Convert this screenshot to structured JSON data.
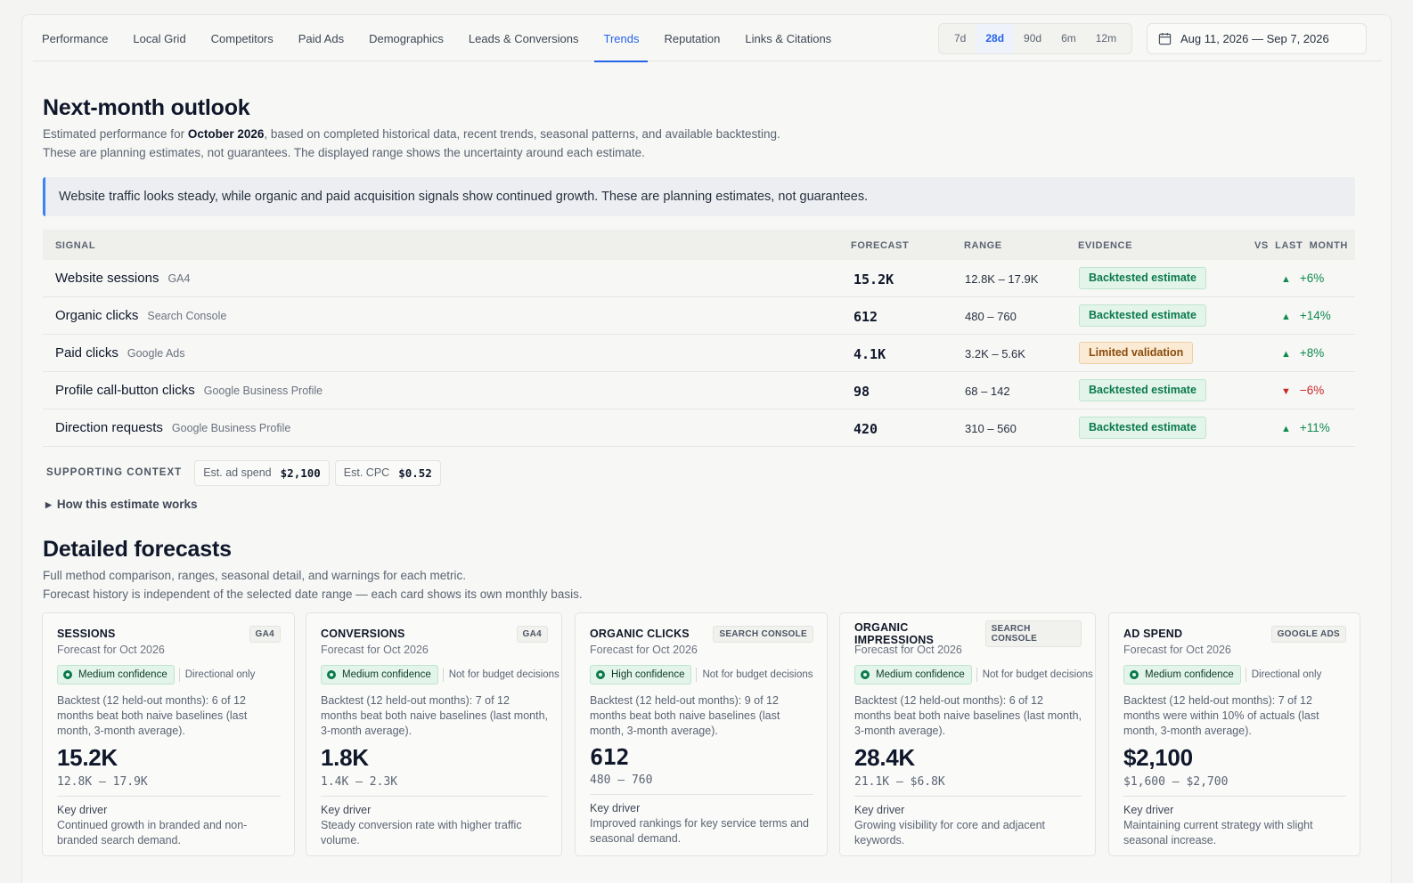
{
  "nav": {
    "tabs": [
      {
        "label": "Performance"
      },
      {
        "label": "Local Grid"
      },
      {
        "label": "Competitors"
      },
      {
        "label": "Paid Ads"
      },
      {
        "label": "Demographics"
      },
      {
        "label": "Leads & Conversions"
      },
      {
        "label": "Trends",
        "active": true
      },
      {
        "label": "Reputation"
      },
      {
        "label": "Links & Citations"
      }
    ],
    "ranges": [
      "7d",
      "28d",
      "90d",
      "6m",
      "12m"
    ],
    "active_range": "28d",
    "date_range": "Aug 11, 2026 — Sep 7, 2026"
  },
  "outlook": {
    "title": "Next-month outlook",
    "sub_pre": "Estimated performance for ",
    "sub_month": "October 2026",
    "sub_post": ", based on completed historical data, recent trends, seasonal patterns, and available backtesting.",
    "sub_line2": "These are planning estimates, not guarantees. The displayed range shows the uncertainty around each estimate.",
    "callout": "Website traffic looks steady, while organic and paid acquisition signals show continued growth. These are planning estimates, not guarantees."
  },
  "signal_table": {
    "headers": {
      "signal": "SIGNAL",
      "forecast": "FORECAST",
      "range": "RANGE",
      "evidence": "EVIDENCE",
      "vs": "VS  LAST  MONTH"
    },
    "rows": [
      {
        "signal": "Website sessions",
        "source": "GA4",
        "forecast": "15.2K",
        "range": "12.8K – 17.9K",
        "evidence": "Backtested estimate",
        "evidence_type": "green",
        "direction": "up",
        "arrow": "▲",
        "change": "+6%"
      },
      {
        "signal": "Organic clicks",
        "source": "Search Console",
        "forecast": "612",
        "range": "480 – 760",
        "evidence": "Backtested estimate",
        "evidence_type": "green",
        "direction": "up",
        "arrow": "▲",
        "change": "+14%"
      },
      {
        "signal": "Paid clicks",
        "source": "Google Ads",
        "forecast": "4.1K",
        "range": "3.2K – 5.6K",
        "evidence": "Limited validation",
        "evidence_type": "amber",
        "direction": "up",
        "arrow": "▲",
        "change": "+8%"
      },
      {
        "signal": "Profile call-button clicks",
        "source": "Google Business Profile",
        "forecast": "98",
        "range": "68 – 142",
        "evidence": "Backtested estimate",
        "evidence_type": "green",
        "direction": "down",
        "arrow": "▼",
        "change": "−6%"
      },
      {
        "signal": "Direction requests",
        "source": "Google Business Profile",
        "forecast": "420",
        "range": "310 – 560",
        "evidence": "Backtested estimate",
        "evidence_type": "green",
        "direction": "up",
        "arrow": "▲",
        "change": "+11%"
      }
    ]
  },
  "support": {
    "label": "SUPPORTING CONTEXT",
    "ad_spend_label": "Est. ad spend",
    "ad_spend_value": "$2,100",
    "cpc_label": "Est. CPC",
    "cpc_value": "$0.52",
    "howto": "How this estimate works"
  },
  "detailed": {
    "title": "Detailed forecasts",
    "sub_line1": "Full method comparison, ranges, seasonal detail, and warnings for each metric.",
    "sub_line2": "Forecast history is independent of the selected date range — each card shows its own monthly basis."
  },
  "cards": [
    {
      "title": "SESSIONS",
      "source": "GA4",
      "for": "Forecast for Oct 2026",
      "confidence": "Medium confidence",
      "note": "Directional only",
      "backtest": "Backtest (12 held-out months): 6 of 12 months beat both naive baselines (last month, 3-month average).",
      "value": "15.2K",
      "range": "12.8K – 17.9K",
      "driver_label": "Key driver",
      "driver": "Continued growth in branded and non-branded search demand."
    },
    {
      "title": "CONVERSIONS",
      "source": "GA4",
      "for": "Forecast for Oct 2026",
      "confidence": "Medium confidence",
      "note": "Not for budget decisions",
      "backtest": "Backtest (12 held-out months): 7 of 12 months beat both naive baselines (last month, 3-month average).",
      "value": "1.8K",
      "range": "1.4K – 2.3K",
      "driver_label": "Key driver",
      "driver": "Steady conversion rate with higher traffic volume."
    },
    {
      "title": "ORGANIC CLICKS",
      "source": "SEARCH CONSOLE",
      "for": "Forecast for Oct 2026",
      "confidence": "High confidence",
      "note": "Not for budget decisions",
      "backtest": "Backtest (12 held-out months): 9 of 12 months beat both naive baselines (last month, 3-month average).",
      "value": "612",
      "range": "480 – 760",
      "driver_label": "Key driver",
      "driver": "Improved rankings for key service terms and seasonal demand."
    },
    {
      "title": "ORGANIC IMPRESSIONS",
      "source": "SEARCH CONSOLE",
      "for": "Forecast for Oct 2026",
      "confidence": "Medium confidence",
      "note": "Not for budget decisions",
      "backtest": "Backtest (12 held-out months): 6 of 12 months beat both naive baselines (last month, 3-month average).",
      "value": "28.4K",
      "range": "21.1K – $6.8K",
      "driver_label": "Key driver",
      "driver": "Growing visibility for core and adjacent keywords."
    },
    {
      "title": "AD SPEND",
      "source": "GOOGLE ADS",
      "for": "Forecast for Oct 2026",
      "confidence": "Medium confidence",
      "note": "Directional only",
      "backtest": "Backtest (12 held-out months): 7 of 12 months were within 10% of actuals (last month, 3-month average).",
      "value": "$2,100",
      "range": "$1,600 – $2,700",
      "driver_label": "Key driver",
      "driver": "Maintaining current strategy with slight seasonal increase."
    }
  ]
}
